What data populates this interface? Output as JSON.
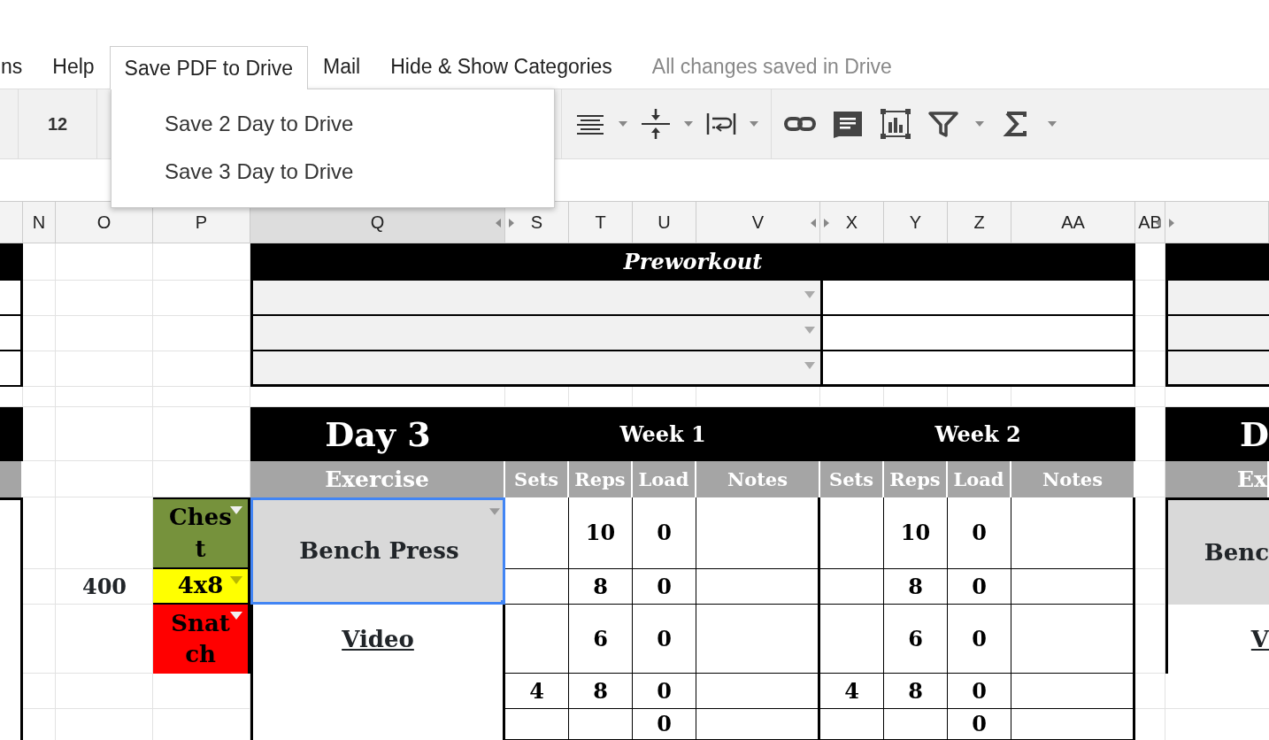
{
  "menu": {
    "items": [
      {
        "label": "ns",
        "open": false
      },
      {
        "label": "Help",
        "open": false
      },
      {
        "label": "Save PDF to Drive",
        "open": true
      },
      {
        "label": "Mail",
        "open": false
      },
      {
        "label": "Hide & Show Categories",
        "open": false
      }
    ],
    "status": "All changes saved in Drive"
  },
  "dropdown_menu": {
    "items": [
      "Save 2 Day to Drive",
      "Save 3 Day to Drive"
    ]
  },
  "toolbar": {
    "font_size": "12"
  },
  "column_headers": [
    {
      "label": "N",
      "selected": false,
      "hidden_next": false
    },
    {
      "label": "O",
      "selected": false,
      "hidden_next": false
    },
    {
      "label": "P",
      "selected": false,
      "hidden_next": false
    },
    {
      "label": "Q",
      "selected": true,
      "hidden_next": true
    },
    {
      "label": "S",
      "selected": false,
      "hidden_next": false
    },
    {
      "label": "T",
      "selected": false,
      "hidden_next": false
    },
    {
      "label": "U",
      "selected": false,
      "hidden_next": false
    },
    {
      "label": "V",
      "selected": false,
      "hidden_next": true
    },
    {
      "label": "X",
      "selected": false,
      "hidden_next": false
    },
    {
      "label": "Y",
      "selected": false,
      "hidden_next": false
    },
    {
      "label": "Z",
      "selected": false,
      "hidden_next": false
    },
    {
      "label": "AA",
      "selected": false,
      "hidden_next": false
    },
    {
      "label": "AB",
      "selected": false,
      "hidden_next": true
    }
  ],
  "preworkout": {
    "title": "Preworkout",
    "rows": [
      {
        "kind": "dropdown"
      },
      {
        "kind": "dropdown"
      },
      {
        "kind": "dropdown"
      }
    ]
  },
  "day": {
    "title": "Day 3",
    "exercise_header": "Exercise",
    "exercise": {
      "name": "Bench Press",
      "selected": true,
      "link": "Video"
    },
    "weight": "400",
    "tags": [
      {
        "label": "Chest",
        "color": "#76923c"
      },
      {
        "label": "4x8",
        "color": "#ffff00"
      },
      {
        "label": "Snatch",
        "color": "#ff0000"
      }
    ],
    "weeks": [
      {
        "title": "Week 1",
        "headers": [
          "Sets",
          "Reps",
          "Load",
          "Notes"
        ],
        "rows": [
          {
            "reps": "10",
            "load": "0"
          },
          {
            "reps": "8",
            "load": "0"
          },
          {
            "reps": "6",
            "load": "0"
          },
          {
            "sets": "4",
            "reps": "8",
            "load": "0"
          },
          {
            "load": "0"
          }
        ]
      },
      {
        "title": "Week 2",
        "headers": [
          "Sets",
          "Reps",
          "Load",
          "Notes"
        ],
        "rows": [
          {
            "reps": "10",
            "load": "0"
          },
          {
            "reps": "8",
            "load": "0"
          },
          {
            "reps": "6",
            "load": "0"
          },
          {
            "sets": "4",
            "reps": "8",
            "load": "0"
          },
          {
            "load": "0"
          }
        ]
      }
    ]
  },
  "next_day": {
    "title": "D",
    "exercise_header": "Ex",
    "exercise": "Benc",
    "link": "V"
  }
}
